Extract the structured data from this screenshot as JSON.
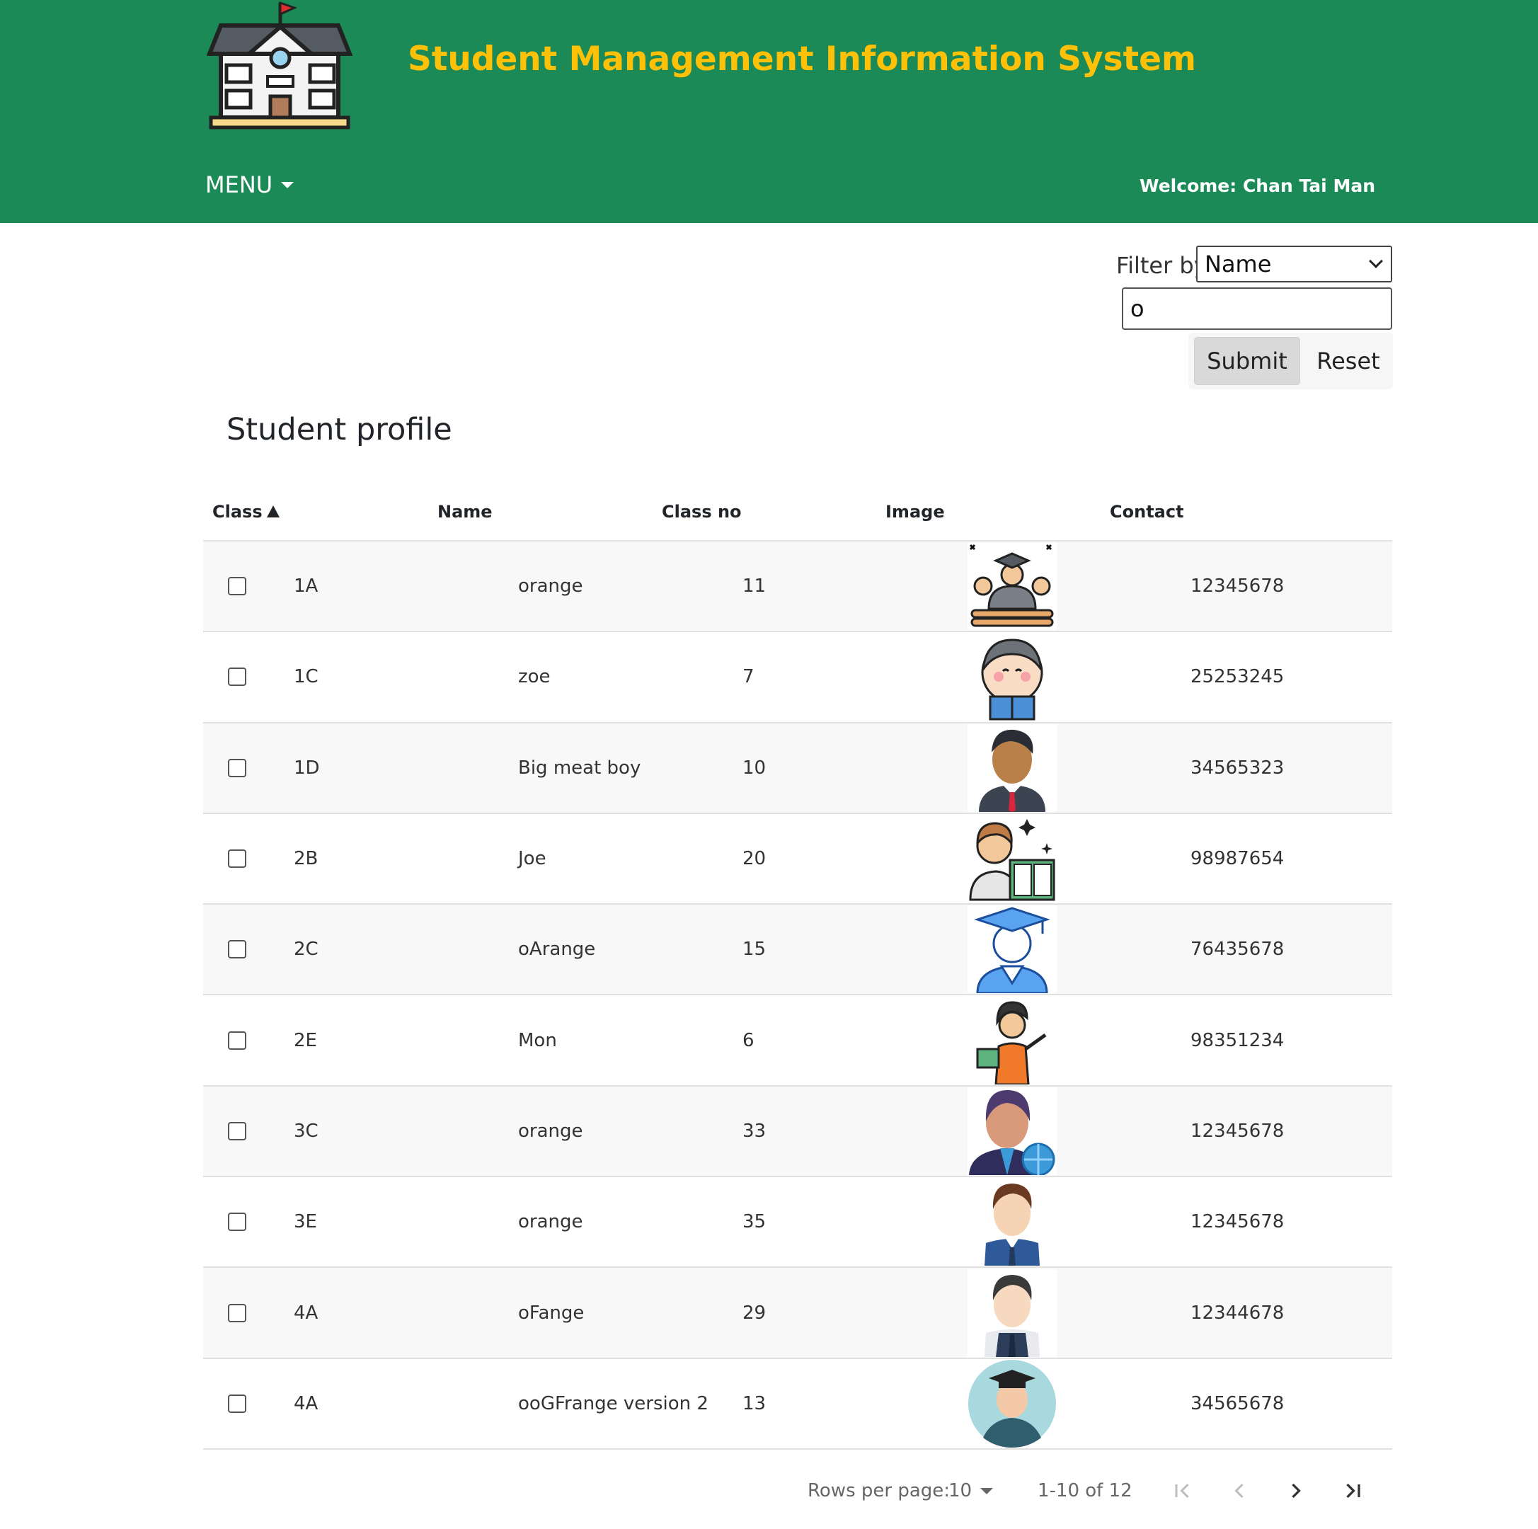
{
  "header": {
    "title": "Student Management Information System",
    "menu_label": "MENU",
    "welcome": "Welcome: Chan Tai Man",
    "brand_color": "#1c8a56",
    "title_color": "#ffc107"
  },
  "filter": {
    "label": "Filter by",
    "selected_field": "Name",
    "search_value": "o",
    "submit_label": "Submit",
    "reset_label": "Reset"
  },
  "table": {
    "title": "Student profile",
    "columns": [
      "Class",
      "Name",
      "Class no",
      "Image",
      "Contact"
    ],
    "sorted_column": "Class",
    "rows": [
      {
        "class": "1A",
        "name": "orange",
        "class_no": "11",
        "contact": "12345678",
        "image": "graduate-muscle-avatar"
      },
      {
        "class": "1C",
        "name": "zoe",
        "class_no": "7",
        "contact": "25253245",
        "image": "kid-reading-avatar"
      },
      {
        "class": "1D",
        "name": "Big meat boy",
        "class_no": "10",
        "contact": "34565323",
        "image": "businessman-tie-avatar"
      },
      {
        "class": "2B",
        "name": "Joe",
        "class_no": "20",
        "contact": "98987654",
        "image": "student-book-avatar"
      },
      {
        "class": "2C",
        "name": "oArange",
        "class_no": "15",
        "contact": "76435678",
        "image": "graduate-blue-avatar"
      },
      {
        "class": "2E",
        "name": "Mon",
        "class_no": "6",
        "contact": "98351234",
        "image": "teacher-woman-avatar"
      },
      {
        "class": "3C",
        "name": "orange",
        "class_no": "33",
        "contact": "12345678",
        "image": "businesswoman-globe-avatar"
      },
      {
        "class": "3E",
        "name": "orange",
        "class_no": "35",
        "contact": "12345678",
        "image": "man-suit-avatar"
      },
      {
        "class": "4A",
        "name": "oFange",
        "class_no": "29",
        "contact": "12344678",
        "image": "man-vest-avatar"
      },
      {
        "class": "4A",
        "name": "ooGFrange version 2",
        "class_no": "13",
        "contact": "34565678",
        "image": "graduate-circle-avatar"
      }
    ]
  },
  "pagination": {
    "rows_per_page_label": "Rows per page:",
    "rows_per_page": "10",
    "range": "1-10 of 12"
  }
}
